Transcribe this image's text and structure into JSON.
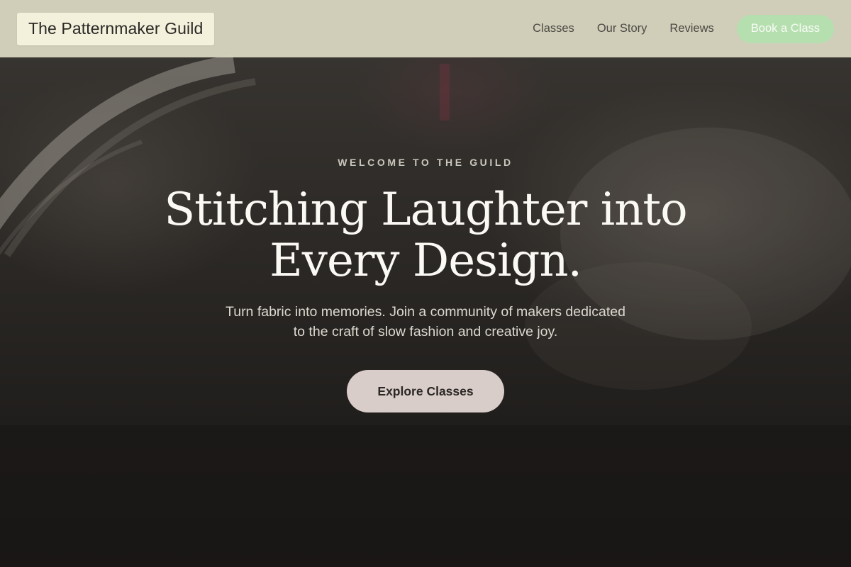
{
  "header": {
    "logo_text": "The Patternmaker Guild",
    "nav": [
      {
        "label": "Classes"
      },
      {
        "label": "Our Story"
      },
      {
        "label": "Reviews"
      }
    ],
    "cta_label": "Book a Class"
  },
  "hero": {
    "eyebrow": "WELCOME TO THE GUILD",
    "headline_line1": "Stitching Laughter into",
    "headline_line2": "Every Design.",
    "subtext_line1": "Turn fabric into memories. Join a community of makers dedicated",
    "subtext_line2": "to the craft of slow fashion and creative joy.",
    "cta_label": "Explore Classes"
  },
  "colors": {
    "header_bg": "#d6d4be",
    "logo_bg": "#f3f1dc",
    "book_button": "#b6dfb0",
    "cta_button": "#d8cdc9",
    "hero_bg": "#1c1a18"
  }
}
